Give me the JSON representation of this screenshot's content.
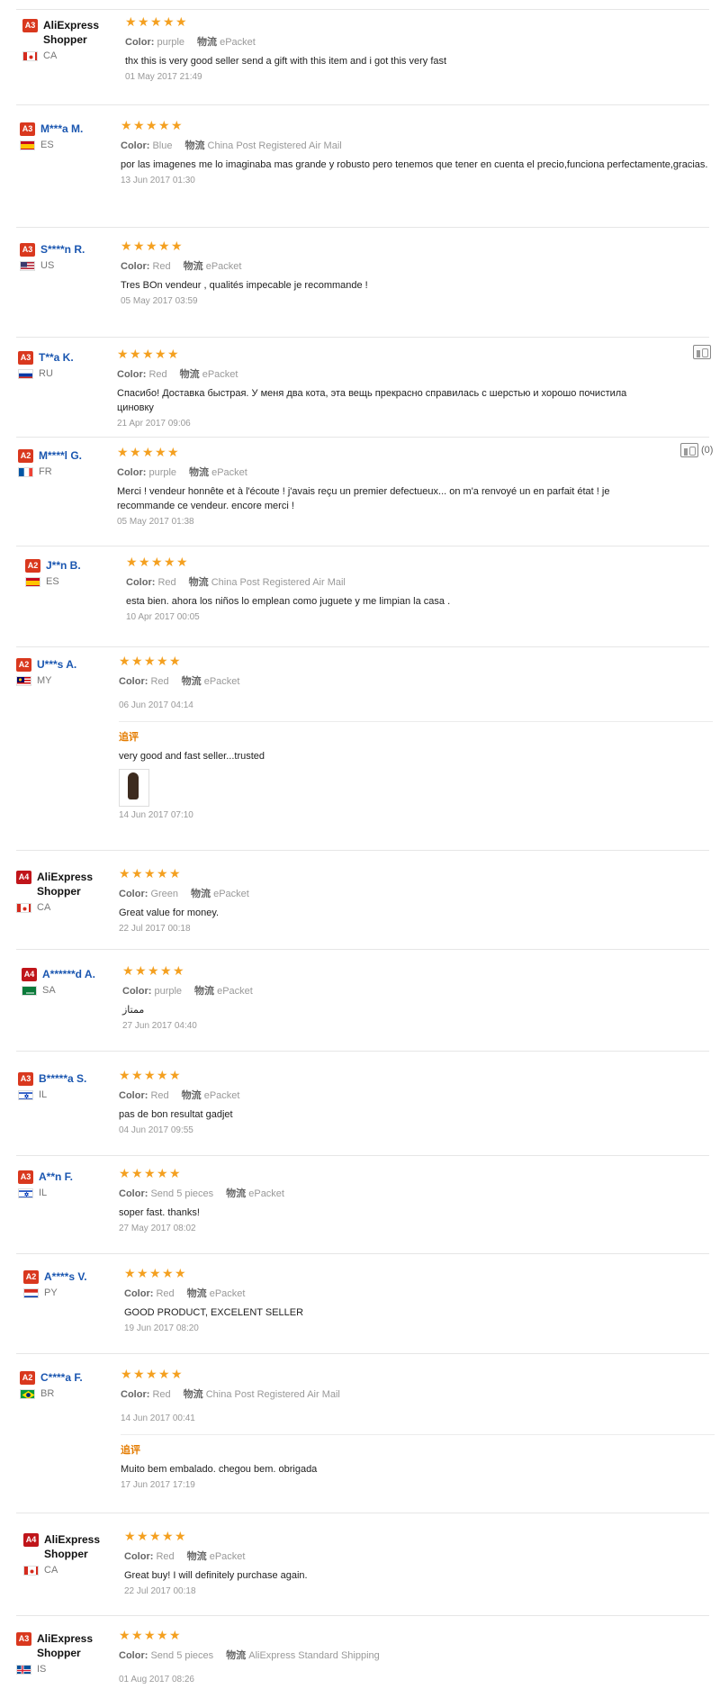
{
  "labels": {
    "color": "Color:",
    "shipping_icon": "物流",
    "append": "追评"
  },
  "like": {
    "count": "(0)"
  },
  "reviews": [
    {
      "level": "A3",
      "name": "AliExpress Shopper",
      "country": "CA",
      "rating": 5,
      "color": "purple",
      "shipping": "ePacket",
      "text": "thx this is very good seller send a gift with this item and i got this very fast",
      "date": "01 May 2017 21:49"
    },
    {
      "level": "A3",
      "name": "M***a M.",
      "country": "ES",
      "rating": 5,
      "color": "Blue",
      "shipping": "China Post Registered Air Mail",
      "text": "por las imagenes me lo imaginaba mas grande y robusto pero tenemos que tener en cuenta el precio,funciona perfectamente,gracias.",
      "date": "13 Jun 2017 01:30"
    },
    {
      "level": "A3",
      "name": "S****n R.",
      "country": "US",
      "rating": 5,
      "color": "Red",
      "shipping": "ePacket",
      "text": "Tres BOn vendeur , qualités impecable je recommande !",
      "date": "05 May 2017 03:59"
    },
    {
      "level": "A3",
      "name": "T**a K.",
      "country": "RU",
      "rating": 5,
      "color": "Red",
      "shipping": "ePacket",
      "text": "Спасибо! Доставка быстрая. У меня два кота, эта вещь прекрасно справилась с шерстью и хорошо почистила циновку",
      "date": "21 Apr 2017 09:06"
    },
    {
      "level": "A2",
      "name": "M****l G.",
      "country": "FR",
      "rating": 5,
      "color": "purple",
      "shipping": "ePacket",
      "text": "Merci ! vendeur honnête et à l'écoute ! j'avais reçu un premier defectueux... on m'a renvoyé un en parfait état ! je recommande ce vendeur. encore merci !",
      "date": "05 May 2017 01:38"
    },
    {
      "level": "A2",
      "name": "J**n B.",
      "country": "ES",
      "rating": 5,
      "color": "Red",
      "shipping": "China Post Registered Air Mail",
      "text": "esta bien. ahora los niños lo emplean como juguete y me limpian la casa .",
      "date": "10 Apr 2017 00:05"
    },
    {
      "level": "A2",
      "name": "U***s A.",
      "country": "MY",
      "rating": 5,
      "color": "Red",
      "shipping": "ePacket",
      "text": "",
      "date": "06 Jun 2017 04:14",
      "append_text": "very good and fast seller...trusted",
      "append_date": "14 Jun 2017 07:10"
    },
    {
      "level": "A4",
      "name": "AliExpress Shopper",
      "country": "CA",
      "rating": 5,
      "color": "Green",
      "shipping": "ePacket",
      "text": "Great value for money.",
      "date": "22 Jul 2017 00:18"
    },
    {
      "level": "A4",
      "name": "A******d A.",
      "country": "SA",
      "rating": 5,
      "color": "purple",
      "shipping": "ePacket",
      "text": "ممتاز",
      "date": "27 Jun 2017 04:40"
    },
    {
      "level": "A3",
      "name": "B*****a S.",
      "country": "IL",
      "rating": 5,
      "color": "Red",
      "shipping": "ePacket",
      "text": "pas de bon resultat gadjet",
      "date": "04 Jun 2017 09:55"
    },
    {
      "level": "A3",
      "name": "A**n F.",
      "country": "IL",
      "rating": 5,
      "color": "Send 5 pieces",
      "shipping": "ePacket",
      "text": "soper fast. thanks!",
      "date": "27 May 2017 08:02"
    },
    {
      "level": "A2",
      "name": "A****s V.",
      "country": "PY",
      "rating": 5,
      "color": "Red",
      "shipping": "ePacket",
      "text": "GOOD PRODUCT, EXCELENT SELLER",
      "date": "19 Jun 2017 08:20"
    },
    {
      "level": "A2",
      "name": "C****a F.",
      "country": "BR",
      "rating": 5,
      "color": "Red",
      "shipping": "China Post Registered Air Mail",
      "text": "",
      "date": "14 Jun 2017 00:41",
      "append_text": "Muito bem embalado. chegou bem. obrigada",
      "append_date": "17 Jun 2017 17:19"
    },
    {
      "level": "A4",
      "name": "AliExpress Shopper",
      "country": "CA",
      "rating": 5,
      "color": "Red",
      "shipping": "ePacket",
      "text": "Great buy! I will definitely purchase again.",
      "date": "22 Jul 2017 00:18"
    },
    {
      "level": "A3",
      "name": "AliExpress Shopper",
      "country": "IS",
      "rating": 5,
      "color": "Send 5 pieces",
      "shipping": "AliExpress Standard Shipping",
      "text": "",
      "date": "01 Aug 2017 08:26"
    }
  ]
}
